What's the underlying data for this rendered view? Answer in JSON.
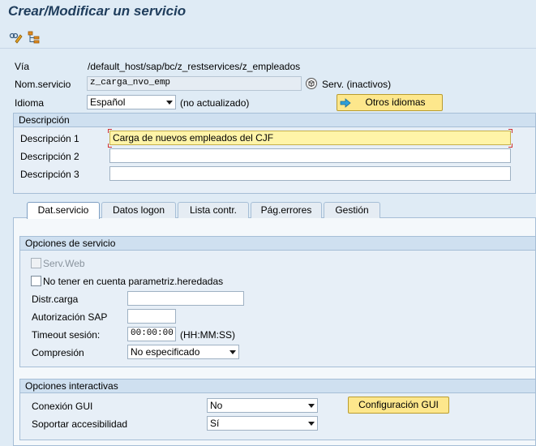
{
  "window": {
    "title": "Crear/Modificar un servicio"
  },
  "toolbar": {
    "icons": [
      "display-change-icon",
      "hierarchy-icon"
    ]
  },
  "header": {
    "via_label": "Vía",
    "via_value": "/default_host/sap/bc/z_restservices/z_empleados",
    "service_label": "Nom.servicio",
    "service_value": "z_carga_nvo_emp",
    "service_status": "Serv. (inactivos)",
    "language_label": "Idioma",
    "language_value": "Español",
    "language_note": "(no actualizado)",
    "other_languages_button": "Otros idiomas"
  },
  "description": {
    "heading": "Descripción",
    "label1": "Descripción 1",
    "value1": "Carga de nuevos empleados del CJF",
    "label2": "Descripción 2",
    "value2": "",
    "label3": "Descripción 3",
    "value3": ""
  },
  "tabs": [
    {
      "label": "Dat.servicio",
      "active": true
    },
    {
      "label": "Datos logon",
      "active": false
    },
    {
      "label": "Lista contr.",
      "active": false
    },
    {
      "label": "Pág.errores",
      "active": false
    },
    {
      "label": "Gestión",
      "active": false
    }
  ],
  "service_options": {
    "heading": "Opciones de servicio",
    "serv_web_label": "Serv.Web",
    "serv_web_checked": false,
    "ignore_inherited_label": "No tener en cuenta parametriz.heredadas",
    "ignore_inherited_checked": false,
    "distr_label": "Distr.carga",
    "distr_value": "",
    "auth_label": "Autorización SAP",
    "auth_value": "",
    "timeout_label": "Timeout sesión:",
    "timeout_value": "00:00:00",
    "timeout_format": "(HH:MM:SS)",
    "compression_label": "Compresión",
    "compression_value": "No especificado"
  },
  "interactive_options": {
    "heading": "Opciones interactivas",
    "gui_label": "Conexión GUI",
    "gui_value": "No",
    "gui_config_button": "Configuración GUI",
    "accessibility_label": "Soportar accesibilidad",
    "accessibility_value": "Sí"
  },
  "colors": {
    "background": "#dfebf5",
    "button": "#fde78c",
    "focus_field": "#fff4a8",
    "title": "#1f3d5c"
  }
}
